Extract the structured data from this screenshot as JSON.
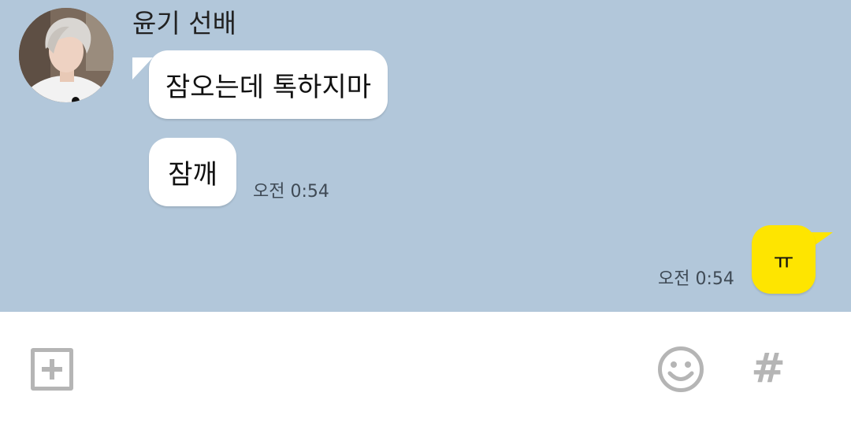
{
  "chat": {
    "sender_name": "윤기 선배",
    "messages": [
      {
        "from": "other",
        "text": "잠오는데 톡하지마"
      },
      {
        "from": "other",
        "text": "잠깨",
        "time": "오전 0:54"
      },
      {
        "from": "me",
        "text": "ㅠ",
        "time": "오전 0:54"
      }
    ]
  },
  "input_bar": {
    "icons": [
      "plus-icon",
      "emoji-icon",
      "hashtag-icon"
    ],
    "hash_glyph": "#"
  },
  "colors": {
    "chat_background": "#b2c7da",
    "my_bubble": "#fee500",
    "other_bubble": "#ffffff",
    "icon_gray": "#b5b5b5"
  }
}
